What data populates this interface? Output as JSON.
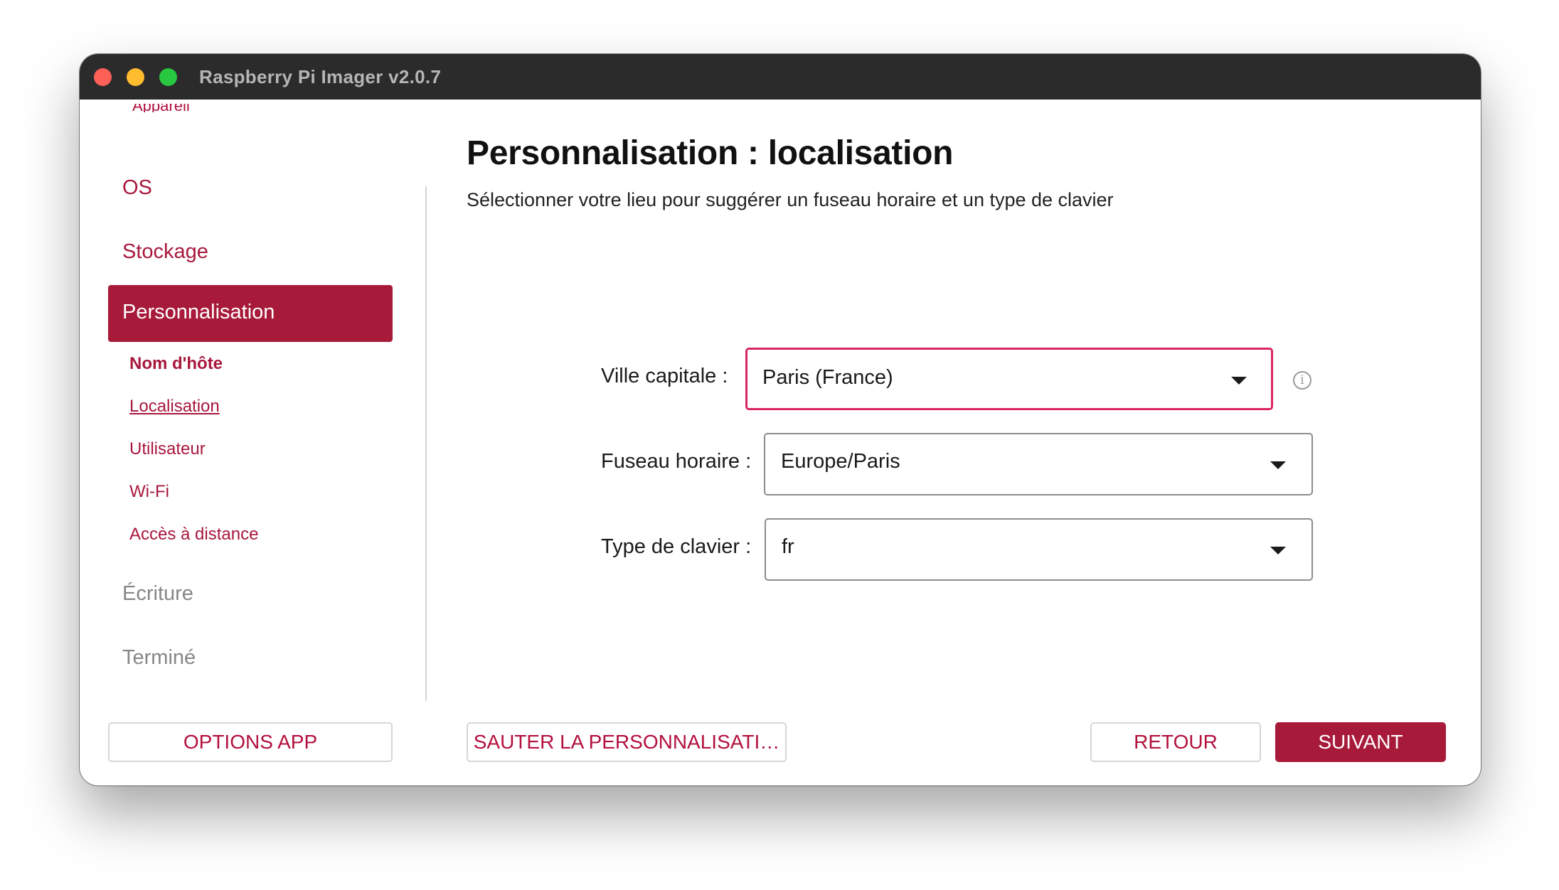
{
  "window": {
    "title": "Raspberry Pi Imager v2.0.7"
  },
  "sidebar": {
    "cut_item": "Appareil",
    "items": [
      {
        "label": "OS"
      },
      {
        "label": "Stockage"
      },
      {
        "label": "Personnalisation",
        "active": true
      },
      {
        "label": "Écriture",
        "disabled": true
      },
      {
        "label": "Terminé",
        "disabled": true
      }
    ],
    "sub_items": [
      {
        "label": "Nom d'hôte"
      },
      {
        "label": "Localisation"
      },
      {
        "label": "Utilisateur"
      },
      {
        "label": "Wi-Fi"
      },
      {
        "label": "Accès à distance"
      }
    ],
    "options_button": "OPTIONS APP"
  },
  "main": {
    "title": "Personnalisation : localisation",
    "subtitle": "Sélectionner votre lieu pour suggérer un fuseau horaire et un type de clavier",
    "fields": {
      "capital": {
        "label": "Ville capitale :",
        "value": "Paris (France)"
      },
      "timezone": {
        "label": "Fuseau horaire :",
        "value": "Europe/Paris"
      },
      "keyboard": {
        "label": "Type de clavier :",
        "value": "fr"
      }
    },
    "info_glyph": "i"
  },
  "footer": {
    "skip_button": "SAUTER LA PERSONNALISATI…",
    "back_button": "RETOUR",
    "next_button": "SUIVANT"
  },
  "colors": {
    "accent": "#a71a3a",
    "focus": "#d9265f",
    "titlebar": "#2b2b2b"
  },
  "icons": [
    "close-icon",
    "minimize-icon",
    "zoom-icon",
    "info-icon",
    "dropdown-caret-icon"
  ]
}
